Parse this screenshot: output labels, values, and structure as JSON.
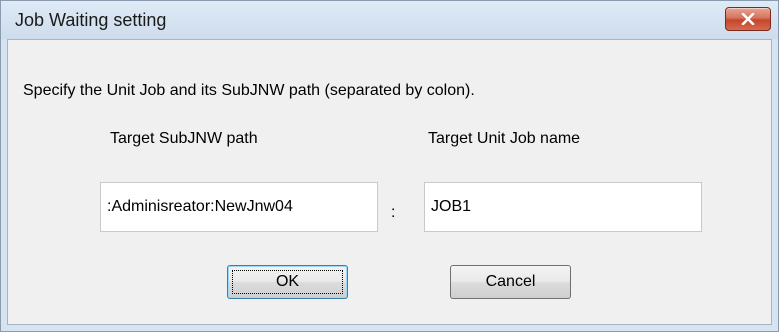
{
  "window": {
    "title": "Job Waiting setting"
  },
  "dialog": {
    "instruction": "Specify the Unit Job and its SubJNW path (separated by colon).",
    "path_label": "Target SubJNW path",
    "job_label": "Target Unit Job name",
    "path_value": ":Adminisreator:NewJnw04",
    "separator": ":",
    "job_value": "JOB1",
    "ok_label": "OK",
    "cancel_label": "Cancel"
  },
  "colors": {
    "title_bar": "#d6e4f2",
    "client_bg": "#f0f0f0",
    "close_button": "#c4472c",
    "focus_border": "#3c7fb1"
  },
  "icons": {
    "close": "close-icon"
  }
}
